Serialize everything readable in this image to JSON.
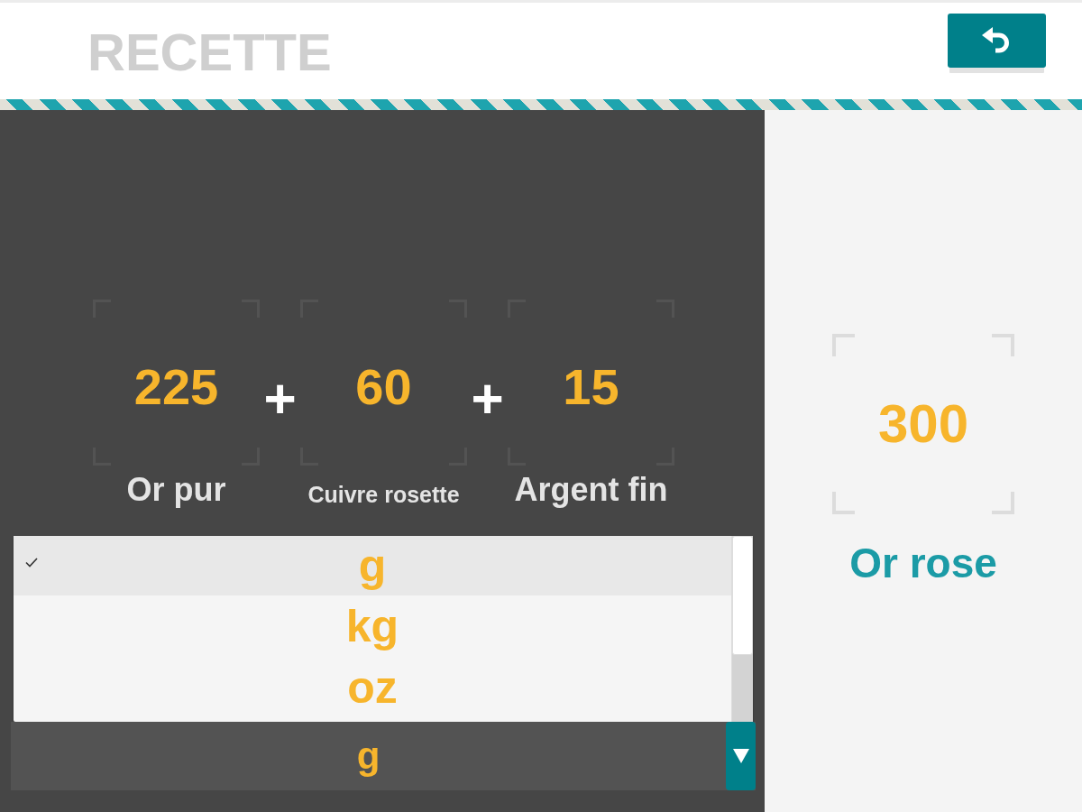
{
  "header": {
    "title": "RECETTE"
  },
  "ingredients": [
    {
      "amount": "225",
      "name": "Or pur"
    },
    {
      "amount": "60",
      "name": "Cuivre rosette"
    },
    {
      "amount": "15",
      "name": "Argent fin"
    }
  ],
  "operators": [
    "+",
    "+"
  ],
  "unit_list": {
    "options": [
      {
        "label": "g",
        "selected": true
      },
      {
        "label": "kg",
        "selected": false
      },
      {
        "label": "oz",
        "selected": false
      }
    ]
  },
  "unit_select": {
    "value": "g"
  },
  "result": {
    "amount": "300",
    "name": "Or rose"
  }
}
